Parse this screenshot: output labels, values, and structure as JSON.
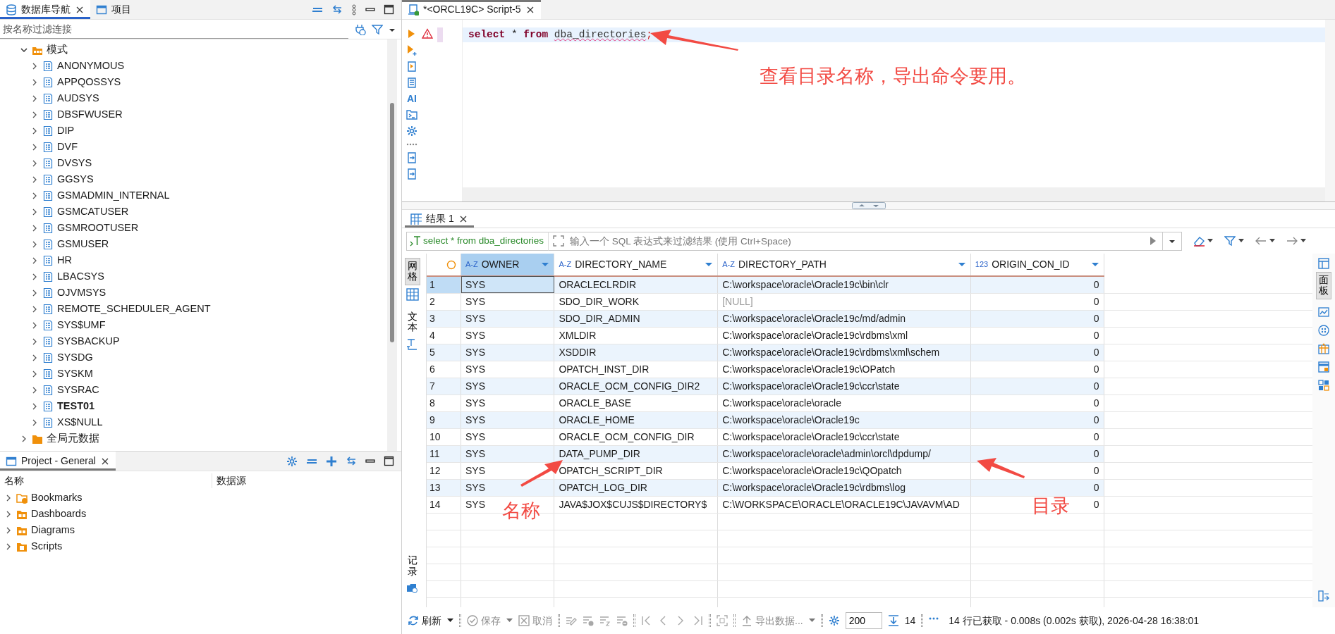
{
  "navigator": {
    "tabs": [
      {
        "label": "数据库导航",
        "selected": true,
        "kind": "database"
      },
      {
        "label": "项目",
        "selected": false,
        "kind": "project"
      }
    ],
    "filter": {
      "placeholder": "按名称过滤连接"
    },
    "tree": [
      {
        "label": "模式",
        "kind": "schemas",
        "expanded": true,
        "children": [
          {
            "label": "ANONYMOUS",
            "bold": false,
            "expanded": false
          },
          {
            "label": "APPQOSSYS",
            "bold": false,
            "expanded": false
          },
          {
            "label": "AUDSYS",
            "bold": false,
            "expanded": false
          },
          {
            "label": "DBSFWUSER",
            "bold": false,
            "expanded": false
          },
          {
            "label": "DIP",
            "bold": false,
            "expanded": false
          },
          {
            "label": "DVF",
            "bold": false,
            "expanded": false
          },
          {
            "label": "DVSYS",
            "bold": false,
            "expanded": false
          },
          {
            "label": "GGSYS",
            "bold": false,
            "expanded": false
          },
          {
            "label": "GSMADMIN_INTERNAL",
            "bold": false,
            "expanded": false
          },
          {
            "label": "GSMCATUSER",
            "bold": false,
            "expanded": false
          },
          {
            "label": "GSMROOTUSER",
            "bold": false,
            "expanded": false
          },
          {
            "label": "GSMUSER",
            "bold": false,
            "expanded": false
          },
          {
            "label": "HR",
            "bold": false,
            "expanded": false
          },
          {
            "label": "LBACSYS",
            "bold": false,
            "expanded": false
          },
          {
            "label": "OJVMSYS",
            "bold": false,
            "expanded": false
          },
          {
            "label": "REMOTE_SCHEDULER_AGENT",
            "bold": false,
            "expanded": false
          },
          {
            "label": "SYS$UMF",
            "bold": false,
            "expanded": false
          },
          {
            "label": "SYSBACKUP",
            "bold": false,
            "expanded": false
          },
          {
            "label": "SYSDG",
            "bold": false,
            "expanded": false
          },
          {
            "label": "SYSKM",
            "bold": false,
            "expanded": false
          },
          {
            "label": "SYSRAC",
            "bold": false,
            "expanded": false
          },
          {
            "label": "TEST01",
            "bold": true,
            "expanded": false
          },
          {
            "label": "XS$NULL",
            "bold": false,
            "expanded": false
          }
        ]
      },
      {
        "label": "全局元数据",
        "kind": "folder",
        "expanded": false
      }
    ]
  },
  "project": {
    "tab": {
      "label": "Project - General"
    },
    "columns": [
      "名称",
      "数据源"
    ],
    "items": [
      {
        "label": "Bookmarks",
        "kind": "bookmarks"
      },
      {
        "label": "Dashboards",
        "kind": "dashboards"
      },
      {
        "label": "Diagrams",
        "kind": "diagrams"
      },
      {
        "label": "Scripts",
        "kind": "scripts"
      }
    ]
  },
  "editor": {
    "tab": {
      "label": "*<ORCL19C> Script-5"
    },
    "tools": [
      {
        "kind": "run"
      },
      {
        "kind": "run-new"
      },
      {
        "kind": "script"
      },
      {
        "kind": "explain"
      },
      {
        "kind": "ai",
        "label": "AI"
      },
      {
        "kind": "console"
      },
      {
        "kind": "settings"
      },
      {
        "kind": "more"
      },
      {
        "kind": "import"
      },
      {
        "kind": "export"
      }
    ],
    "lines": [
      {
        "warning": true,
        "current": true,
        "tokens": [
          {
            "text": "select",
            "kind": "keyword"
          },
          {
            "text": " * ",
            "kind": "plain"
          },
          {
            "text": "from",
            "kind": "keyword"
          },
          {
            "text": "dba_directories",
            "kind": "unknown"
          },
          {
            "text": ";",
            "kind": "punct"
          }
        ]
      }
    ]
  },
  "annotations": [
    {
      "text": "查看目录名称，导出命令要用。",
      "kind": "note"
    },
    {
      "text": "名称",
      "kind": "name"
    },
    {
      "text": "目录",
      "kind": "dir"
    }
  ],
  "results": {
    "tabs": [
      {
        "label": "结果 1",
        "selected": true
      }
    ],
    "query": "select * from dba_directories",
    "filter": {
      "placeholder": "输入一个 SQL 表达式来过滤结果 (使用 Ctrl+Space)"
    },
    "side_tabs": [
      {
        "label": "网格",
        "kind": "grid",
        "selected": true
      },
      {
        "label": "文本",
        "kind": "text",
        "selected": false
      },
      {
        "label": "记录",
        "kind": "record",
        "selected": false
      }
    ],
    "panel_tab": {
      "label": "面板"
    },
    "columns": [
      {
        "label": "OWNER",
        "type_label": "A-Z",
        "selected": true
      },
      {
        "label": "DIRECTORY_NAME",
        "type_label": "A-Z",
        "selected": false
      },
      {
        "label": "DIRECTORY_PATH",
        "type_label": "A-Z",
        "selected": false
      },
      {
        "label": "ORIGIN_CON_ID",
        "type_label": "123",
        "selected": false
      }
    ],
    "rows": [
      {
        "num": "1",
        "owner": "SYS",
        "directory_name": "ORACLECLRDIR",
        "directory_path": "C:\\workspace\\oracle\\Oracle19c\\bin\\clr",
        "path_null": false,
        "origin_con_id": "0",
        "selected": true
      },
      {
        "num": "2",
        "owner": "SYS",
        "directory_name": "SDO_DIR_WORK",
        "directory_path": "[NULL]",
        "path_null": true,
        "origin_con_id": "0",
        "selected": false
      },
      {
        "num": "3",
        "owner": "SYS",
        "directory_name": "SDO_DIR_ADMIN",
        "directory_path": "C:\\workspace\\oracle\\Oracle19c/md/admin",
        "path_null": false,
        "origin_con_id": "0",
        "selected": false
      },
      {
        "num": "4",
        "owner": "SYS",
        "directory_name": "XMLDIR",
        "directory_path": "C:\\workspace\\oracle\\Oracle19c\\rdbms\\xml",
        "path_null": false,
        "origin_con_id": "0",
        "selected": false
      },
      {
        "num": "5",
        "owner": "SYS",
        "directory_name": "XSDDIR",
        "directory_path": "C:\\workspace\\oracle\\Oracle19c\\rdbms\\xml\\schem",
        "path_null": false,
        "origin_con_id": "0",
        "selected": false
      },
      {
        "num": "6",
        "owner": "SYS",
        "directory_name": "OPATCH_INST_DIR",
        "directory_path": "C:\\workspace\\oracle\\Oracle19c\\OPatch",
        "path_null": false,
        "origin_con_id": "0",
        "selected": false
      },
      {
        "num": "7",
        "owner": "SYS",
        "directory_name": "ORACLE_OCM_CONFIG_DIR2",
        "directory_path": "C:\\workspace\\oracle\\Oracle19c\\ccr\\state",
        "path_null": false,
        "origin_con_id": "0",
        "selected": false
      },
      {
        "num": "8",
        "owner": "SYS",
        "directory_name": "ORACLE_BASE",
        "directory_path": "C:\\workspace\\oracle\\oracle",
        "path_null": false,
        "origin_con_id": "0",
        "selected": false
      },
      {
        "num": "9",
        "owner": "SYS",
        "directory_name": "ORACLE_HOME",
        "directory_path": "C:\\workspace\\oracle\\Oracle19c",
        "path_null": false,
        "origin_con_id": "0",
        "selected": false
      },
      {
        "num": "10",
        "owner": "SYS",
        "directory_name": "ORACLE_OCM_CONFIG_DIR",
        "directory_path": "C:\\workspace\\oracle\\Oracle19c\\ccr\\state",
        "path_null": false,
        "origin_con_id": "0",
        "selected": false
      },
      {
        "num": "11",
        "owner": "SYS",
        "directory_name": "DATA_PUMP_DIR",
        "directory_path": "C:\\workspace\\oracle\\oracle\\admin\\orcl\\dpdump/",
        "path_null": false,
        "origin_con_id": "0",
        "selected": false
      },
      {
        "num": "12",
        "owner": "SYS",
        "directory_name": "OPATCH_SCRIPT_DIR",
        "directory_path": "C:\\workspace\\oracle\\Oracle19c\\QOpatch",
        "path_null": false,
        "origin_con_id": "0",
        "selected": false
      },
      {
        "num": "13",
        "owner": "SYS",
        "directory_name": "OPATCH_LOG_DIR",
        "directory_path": "C:\\workspace\\oracle\\Oracle19c\\rdbms\\log",
        "path_null": false,
        "origin_con_id": "0",
        "selected": false
      },
      {
        "num": "14",
        "owner": "SYS",
        "directory_name": "JAVA$JOX$CUJS$DIRECTORY$",
        "directory_path": "C:\\WORKSPACE\\ORACLE\\ORACLE19C\\JAVAVM\\AD",
        "path_null": false,
        "origin_con_id": "0",
        "selected": false
      }
    ],
    "toolbar": [
      {
        "kind": "refresh",
        "label": "刷新",
        "disabled": false,
        "dropdown": true
      },
      {
        "kind": "separator"
      },
      {
        "kind": "save",
        "label": "保存",
        "disabled": true,
        "dropdown": true
      },
      {
        "kind": "cancel",
        "label": "取消",
        "disabled": true,
        "dropdown": false
      },
      {
        "kind": "separator"
      },
      {
        "kind": "edit",
        "disabled": true
      },
      {
        "kind": "add-row",
        "disabled": true
      },
      {
        "kind": "copy-row",
        "disabled": true
      },
      {
        "kind": "delete-row",
        "disabled": true
      },
      {
        "kind": "separator"
      },
      {
        "kind": "first",
        "disabled": true
      },
      {
        "kind": "prev",
        "disabled": true
      },
      {
        "kind": "next",
        "disabled": true
      },
      {
        "kind": "last",
        "disabled": true
      },
      {
        "kind": "separator"
      },
      {
        "kind": "page",
        "disabled": true
      },
      {
        "kind": "separator"
      },
      {
        "kind": "export",
        "label": "导出数据...",
        "disabled": true,
        "dropdown": true
      },
      {
        "kind": "separator"
      },
      {
        "kind": "settings",
        "disabled": false
      },
      {
        "kind": "fetch-size",
        "value": "200"
      },
      {
        "kind": "fetch-all",
        "disabled": false
      },
      {
        "kind": "count",
        "label": "14"
      },
      {
        "kind": "separator"
      },
      {
        "kind": "more",
        "disabled": false
      }
    ],
    "status": "14 行已获取 - 0.008s (0.002s 获取), 2026-04-28 16:38:01"
  }
}
